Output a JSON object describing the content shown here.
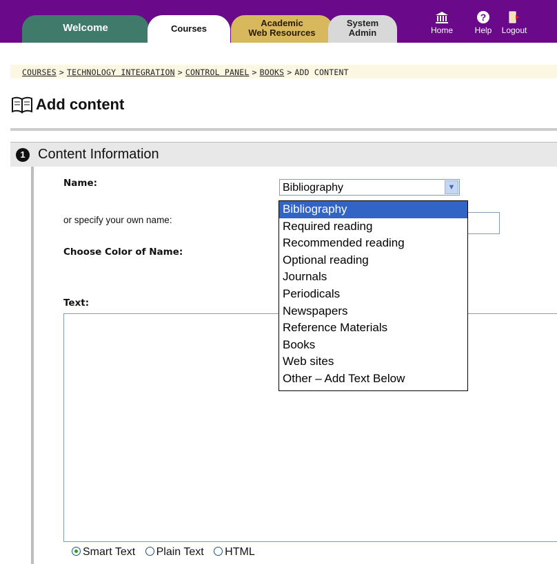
{
  "nav": {
    "tabs": [
      {
        "label": "Welcome"
      },
      {
        "label": "Courses"
      },
      {
        "label_line1": "Academic",
        "label_line2": "Web Resources"
      },
      {
        "label_line1": "System",
        "label_line2": "Admin"
      }
    ],
    "icons": [
      {
        "label": "Home",
        "icon": "museum-home-icon"
      },
      {
        "label": "Help",
        "icon": "question-icon"
      },
      {
        "label": "Logout",
        "icon": "door-exit-icon"
      }
    ],
    "colors": {
      "bar": "#6a0a8a",
      "welcome_tab": "#3f7a6a",
      "academic_tab": "#d7b85c"
    }
  },
  "breadcrumb": [
    {
      "label": "COURSES",
      "link": true
    },
    {
      "label": "TECHNOLOGY INTEGRATION",
      "link": true
    },
    {
      "label": "CONTROL PANEL",
      "link": true
    },
    {
      "label": "BOOKS",
      "link": true
    },
    {
      "label": "ADD CONTENT",
      "link": false
    }
  ],
  "breadcrumb_separator": ">",
  "page": {
    "title": "Add content",
    "icon": "book-icon"
  },
  "section": {
    "number": "1",
    "title": "Content Information"
  },
  "form": {
    "name_label": "Name:",
    "own_name_label": "or specify your own name:",
    "color_label": "Choose Color of Name:",
    "text_label": "Text:",
    "name_select": {
      "value": "Bibliography",
      "options": [
        "Bibliography",
        "Required reading",
        "Recommended reading",
        "Optional reading",
        "Journals",
        "Periodicals",
        "Newspapers",
        "Reference Materials",
        "Books",
        "Web sites",
        "Other – Add Text Below"
      ]
    },
    "text_format": [
      {
        "label": "Smart Text",
        "checked": true
      },
      {
        "label": "Plain Text",
        "checked": false
      },
      {
        "label": "HTML",
        "checked": false
      }
    ]
  }
}
